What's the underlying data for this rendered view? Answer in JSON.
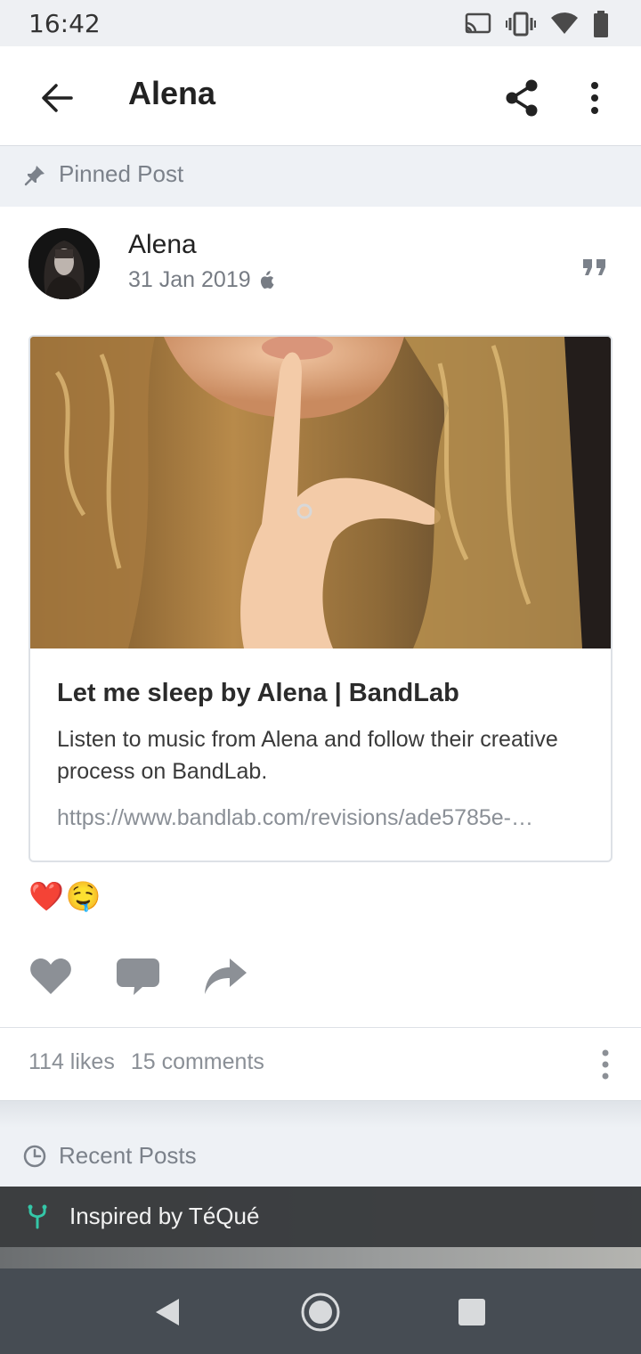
{
  "status_bar": {
    "time": "16:42",
    "icons": [
      "cast-icon",
      "vibrate-icon",
      "wifi-icon",
      "battery-icon"
    ]
  },
  "app_bar": {
    "title": "Alena",
    "icons": [
      "back-arrow-icon",
      "share-icon",
      "more-vert-icon"
    ]
  },
  "pinned_header": {
    "label": "Pinned Post",
    "icon": "pin-icon"
  },
  "post": {
    "author": "Alena",
    "date": "31 Jan 2019",
    "platform_icon": "apple-icon",
    "quote_icon": "quote-icon",
    "link_preview": {
      "title": "Let me sleep by Alena | BandLab",
      "description": "Listen to music from Alena and follow their creative process on BandLab.",
      "url": "https://www.bandlab.com/revisions/ade5785e-…"
    },
    "reactions": [
      "❤️",
      "🤤"
    ],
    "actions": [
      "heart-icon",
      "comment-icon",
      "share-arrow-icon"
    ],
    "likes": "114 likes",
    "comments": "15 comments"
  },
  "recent_header": {
    "label": "Recent Posts",
    "icon": "clock-icon"
  },
  "recent_post": {
    "label": "Inspired by TéQué",
    "icon": "fork-icon",
    "accent": "#34c7a8"
  },
  "nav_bar": {
    "icons": [
      "nav-back-icon",
      "nav-home-icon",
      "nav-recents-icon"
    ]
  }
}
